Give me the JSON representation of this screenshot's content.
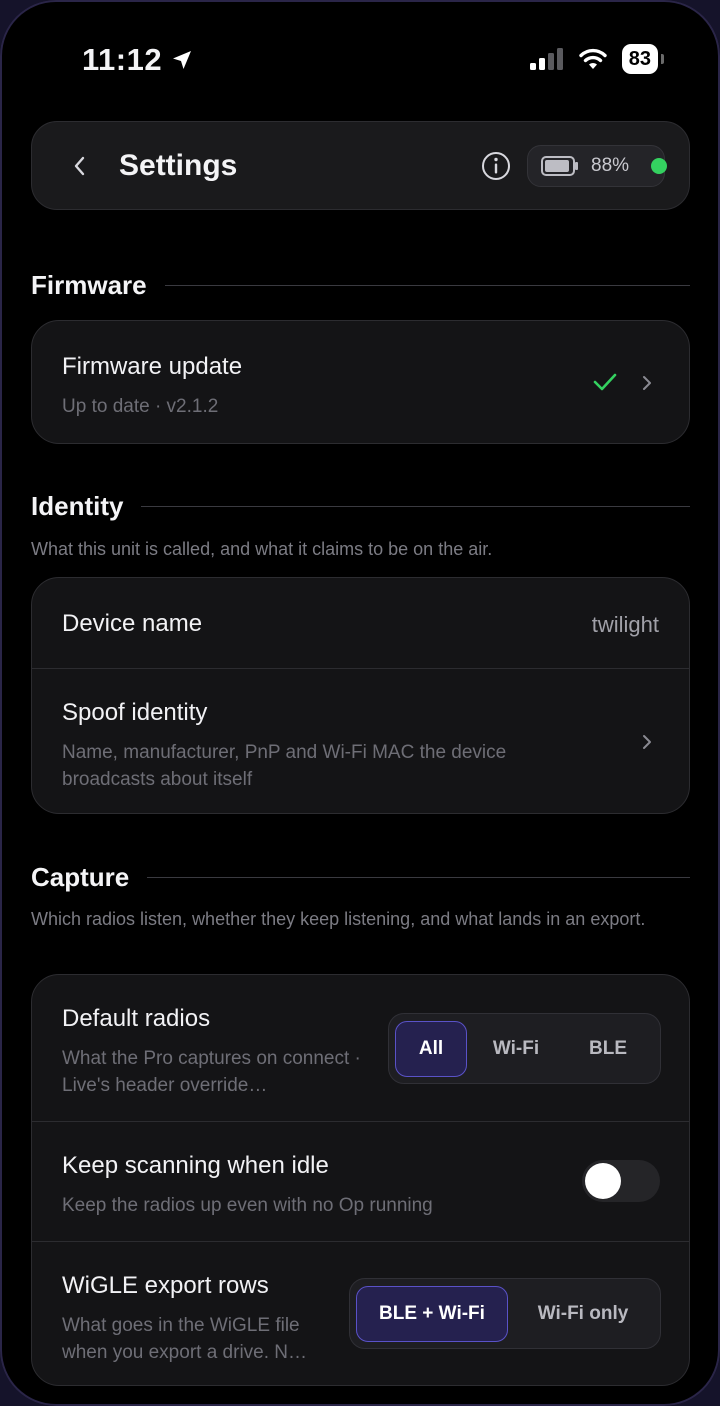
{
  "status_bar": {
    "time": "11:12",
    "battery": "83"
  },
  "header": {
    "title": "Settings",
    "battery_percent": "88%"
  },
  "sections": {
    "firmware": {
      "label": "Firmware",
      "update": {
        "title": "Firmware update",
        "subtitle": "Up to date · v2.1.2"
      }
    },
    "identity": {
      "label": "Identity",
      "description": "What this unit is called, and what it claims to be on the air.",
      "device_name": {
        "title": "Device name",
        "value": "twilight"
      },
      "spoof": {
        "title": "Spoof identity",
        "subtitle": "Name, manufacturer, PnP and Wi-Fi MAC the device broadcasts about itself"
      }
    },
    "capture": {
      "label": "Capture",
      "description": "Which radios listen, whether they keep listening, and what lands in an export.",
      "default_radios": {
        "title": "Default radios",
        "subtitle": "What the Pro captures on connect · Live's header override…",
        "options": [
          "All",
          "Wi-Fi",
          "BLE"
        ],
        "selected": "All"
      },
      "keep_scanning": {
        "title": "Keep scanning when idle",
        "subtitle": "Keep the radios up even with no Op running",
        "enabled": false
      },
      "wigle_rows": {
        "title": "WiGLE export rows",
        "subtitle": "What goes in the WiGLE file when you export a drive. N…",
        "options": [
          "BLE + Wi-Fi",
          "Wi-Fi only"
        ],
        "selected": "BLE + Wi-Fi"
      }
    }
  },
  "colors": {
    "accent": "#5a52c8",
    "ok": "#34d160",
    "card": "#141416"
  }
}
